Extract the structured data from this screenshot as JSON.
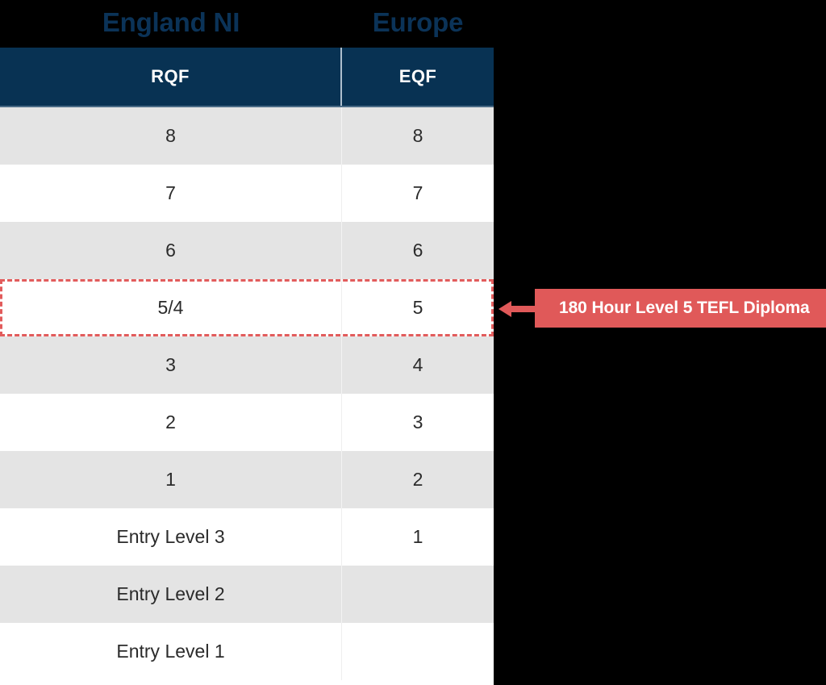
{
  "titles": {
    "left": "England NI",
    "right": "Europe"
  },
  "table": {
    "headers": [
      "RQF",
      "EQF"
    ],
    "rows": [
      {
        "rqf": "8",
        "eqf": "8"
      },
      {
        "rqf": "7",
        "eqf": "7"
      },
      {
        "rqf": "6",
        "eqf": "6"
      },
      {
        "rqf": "5/4",
        "eqf": "5"
      },
      {
        "rqf": "3",
        "eqf": "4"
      },
      {
        "rqf": "2",
        "eqf": "3"
      },
      {
        "rqf": "1",
        "eqf": "2"
      },
      {
        "rqf": "Entry Level 3",
        "eqf": "1"
      },
      {
        "rqf": "Entry Level 2",
        "eqf": ""
      },
      {
        "rqf": "Entry Level 1",
        "eqf": ""
      }
    ],
    "highlighted_row_index": 3
  },
  "callout": {
    "label": "180 Hour Level 5 TEFL Diploma",
    "arrow_icon": "arrow-left-icon"
  },
  "colors": {
    "header_navy": "#083253",
    "title_navy": "#0B3358",
    "stripe_gray": "#e4e4e4",
    "accent_red": "#e05959",
    "dashed_red": "#e25c5c",
    "row_white": "#ffffff",
    "text_dark": "#2b2b2b",
    "background": "#000000"
  }
}
